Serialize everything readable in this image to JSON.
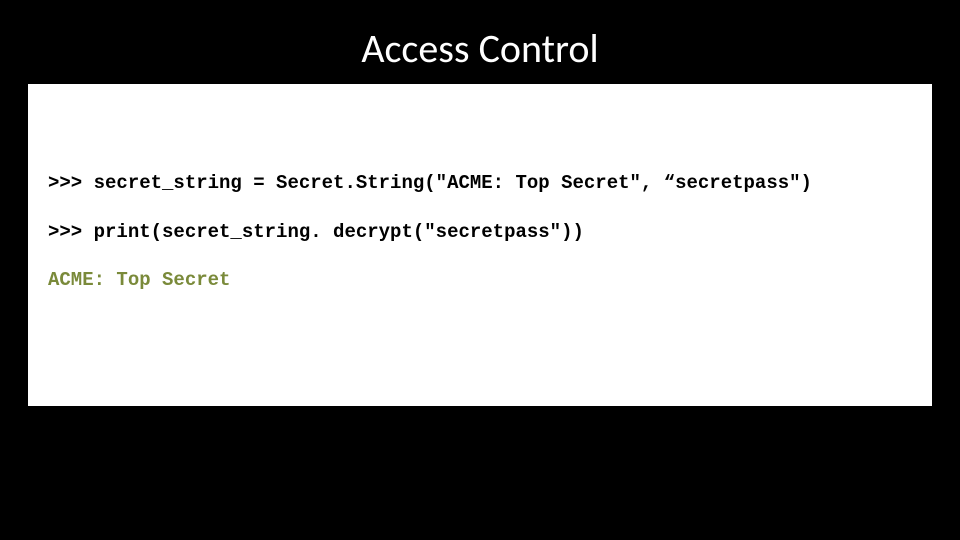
{
  "title": "Access Control",
  "code": {
    "line1": ">>> secret_string = Secret.String(\"ACME: Top Secret\", “secretpass\")",
    "line2": ">>> print(secret_string. decrypt(\"secretpass\"))",
    "output": "ACME: Top Secret"
  }
}
